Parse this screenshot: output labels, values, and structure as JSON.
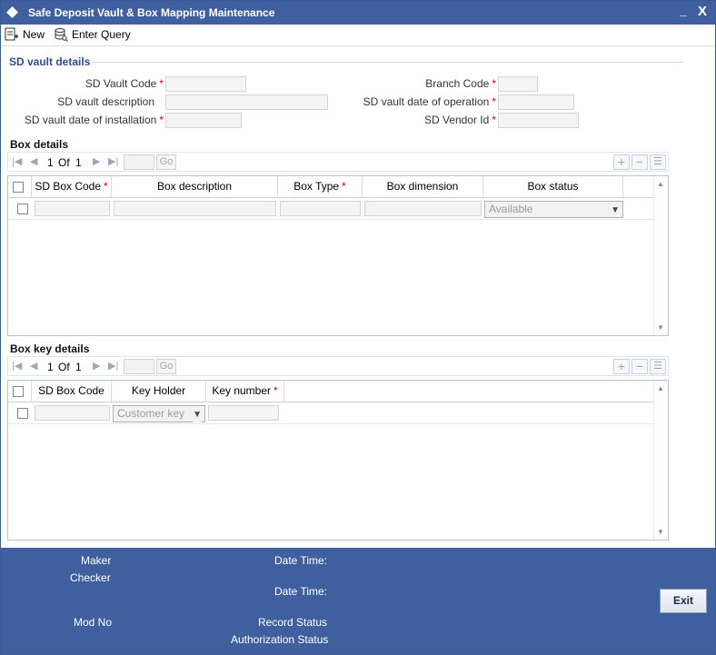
{
  "window": {
    "title": "Safe Deposit Vault & Box Mapping Maintenance",
    "minimize_label": "_",
    "close_label": "X"
  },
  "toolbar": {
    "new_label": "New",
    "enter_query_label": "Enter Query"
  },
  "vault_details": {
    "section_title": "SD vault details",
    "fields": {
      "vault_code": {
        "label": "SD Vault Code",
        "required": "*",
        "value": ""
      },
      "description": {
        "label": "SD vault description",
        "value": ""
      },
      "installation_date": {
        "label": "SD vault date of installation",
        "required": "*",
        "value": ""
      },
      "branch_code": {
        "label": "Branch Code",
        "required": "*",
        "value": ""
      },
      "operation_date": {
        "label": "SD vault date of operation",
        "required": "*",
        "value": ""
      },
      "vendor_id": {
        "label": "SD Vendor Id",
        "required": "*",
        "value": ""
      }
    }
  },
  "box_details": {
    "title": "Box details",
    "nav": {
      "page": "1",
      "of": "Of",
      "total": "1",
      "go": "Go"
    },
    "columns": {
      "box_code": "SD Box Code",
      "box_code_req": "*",
      "description": "Box description",
      "type": "Box Type",
      "type_req": "*",
      "dimension": "Box dimension",
      "status": "Box status"
    },
    "rows": [
      {
        "box_code": "",
        "description": "",
        "type": "",
        "dimension": "",
        "status": "Available"
      }
    ]
  },
  "box_key_details": {
    "title": "Box key details",
    "nav": {
      "page": "1",
      "of": "Of",
      "total": "1",
      "go": "Go"
    },
    "columns": {
      "box_code": "SD Box Code",
      "key_holder": "Key Holder",
      "key_number": "Key number",
      "key_number_req": "*"
    },
    "rows": [
      {
        "box_code": "",
        "key_holder": "Customer key",
        "key_number": ""
      }
    ]
  },
  "footer": {
    "maker": "Maker",
    "checker": "Checker",
    "date_time_1": "Date Time:",
    "date_time_2": "Date Time:",
    "mod_no": "Mod No",
    "record_status": "Record Status",
    "authorization_status": "Authorization Status",
    "exit_label": "Exit"
  },
  "colors": {
    "titlebar": "#3f5f9e",
    "section_heading": "#2e4e8a",
    "required": "#cc0000"
  }
}
